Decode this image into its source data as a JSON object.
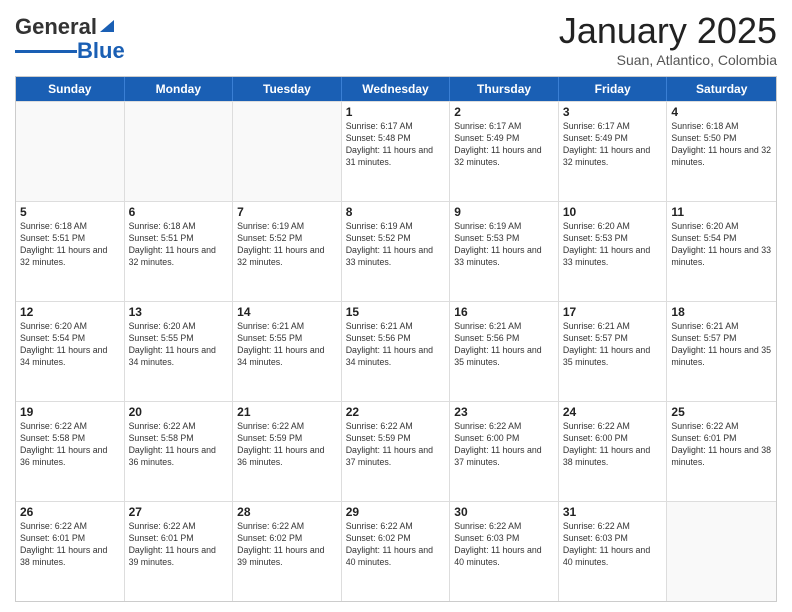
{
  "header": {
    "logo_general": "General",
    "logo_blue": "Blue",
    "month_title": "January 2025",
    "subtitle": "Suan, Atlantico, Colombia"
  },
  "weekdays": [
    "Sunday",
    "Monday",
    "Tuesday",
    "Wednesday",
    "Thursday",
    "Friday",
    "Saturday"
  ],
  "weeks": [
    [
      {
        "day": "",
        "info": ""
      },
      {
        "day": "",
        "info": ""
      },
      {
        "day": "",
        "info": ""
      },
      {
        "day": "1",
        "info": "Sunrise: 6:17 AM\nSunset: 5:48 PM\nDaylight: 11 hours and 31 minutes."
      },
      {
        "day": "2",
        "info": "Sunrise: 6:17 AM\nSunset: 5:49 PM\nDaylight: 11 hours and 32 minutes."
      },
      {
        "day": "3",
        "info": "Sunrise: 6:17 AM\nSunset: 5:49 PM\nDaylight: 11 hours and 32 minutes."
      },
      {
        "day": "4",
        "info": "Sunrise: 6:18 AM\nSunset: 5:50 PM\nDaylight: 11 hours and 32 minutes."
      }
    ],
    [
      {
        "day": "5",
        "info": "Sunrise: 6:18 AM\nSunset: 5:51 PM\nDaylight: 11 hours and 32 minutes."
      },
      {
        "day": "6",
        "info": "Sunrise: 6:18 AM\nSunset: 5:51 PM\nDaylight: 11 hours and 32 minutes."
      },
      {
        "day": "7",
        "info": "Sunrise: 6:19 AM\nSunset: 5:52 PM\nDaylight: 11 hours and 32 minutes."
      },
      {
        "day": "8",
        "info": "Sunrise: 6:19 AM\nSunset: 5:52 PM\nDaylight: 11 hours and 33 minutes."
      },
      {
        "day": "9",
        "info": "Sunrise: 6:19 AM\nSunset: 5:53 PM\nDaylight: 11 hours and 33 minutes."
      },
      {
        "day": "10",
        "info": "Sunrise: 6:20 AM\nSunset: 5:53 PM\nDaylight: 11 hours and 33 minutes."
      },
      {
        "day": "11",
        "info": "Sunrise: 6:20 AM\nSunset: 5:54 PM\nDaylight: 11 hours and 33 minutes."
      }
    ],
    [
      {
        "day": "12",
        "info": "Sunrise: 6:20 AM\nSunset: 5:54 PM\nDaylight: 11 hours and 34 minutes."
      },
      {
        "day": "13",
        "info": "Sunrise: 6:20 AM\nSunset: 5:55 PM\nDaylight: 11 hours and 34 minutes."
      },
      {
        "day": "14",
        "info": "Sunrise: 6:21 AM\nSunset: 5:55 PM\nDaylight: 11 hours and 34 minutes."
      },
      {
        "day": "15",
        "info": "Sunrise: 6:21 AM\nSunset: 5:56 PM\nDaylight: 11 hours and 34 minutes."
      },
      {
        "day": "16",
        "info": "Sunrise: 6:21 AM\nSunset: 5:56 PM\nDaylight: 11 hours and 35 minutes."
      },
      {
        "day": "17",
        "info": "Sunrise: 6:21 AM\nSunset: 5:57 PM\nDaylight: 11 hours and 35 minutes."
      },
      {
        "day": "18",
        "info": "Sunrise: 6:21 AM\nSunset: 5:57 PM\nDaylight: 11 hours and 35 minutes."
      }
    ],
    [
      {
        "day": "19",
        "info": "Sunrise: 6:22 AM\nSunset: 5:58 PM\nDaylight: 11 hours and 36 minutes."
      },
      {
        "day": "20",
        "info": "Sunrise: 6:22 AM\nSunset: 5:58 PM\nDaylight: 11 hours and 36 minutes."
      },
      {
        "day": "21",
        "info": "Sunrise: 6:22 AM\nSunset: 5:59 PM\nDaylight: 11 hours and 36 minutes."
      },
      {
        "day": "22",
        "info": "Sunrise: 6:22 AM\nSunset: 5:59 PM\nDaylight: 11 hours and 37 minutes."
      },
      {
        "day": "23",
        "info": "Sunrise: 6:22 AM\nSunset: 6:00 PM\nDaylight: 11 hours and 37 minutes."
      },
      {
        "day": "24",
        "info": "Sunrise: 6:22 AM\nSunset: 6:00 PM\nDaylight: 11 hours and 38 minutes."
      },
      {
        "day": "25",
        "info": "Sunrise: 6:22 AM\nSunset: 6:01 PM\nDaylight: 11 hours and 38 minutes."
      }
    ],
    [
      {
        "day": "26",
        "info": "Sunrise: 6:22 AM\nSunset: 6:01 PM\nDaylight: 11 hours and 38 minutes."
      },
      {
        "day": "27",
        "info": "Sunrise: 6:22 AM\nSunset: 6:01 PM\nDaylight: 11 hours and 39 minutes."
      },
      {
        "day": "28",
        "info": "Sunrise: 6:22 AM\nSunset: 6:02 PM\nDaylight: 11 hours and 39 minutes."
      },
      {
        "day": "29",
        "info": "Sunrise: 6:22 AM\nSunset: 6:02 PM\nDaylight: 11 hours and 40 minutes."
      },
      {
        "day": "30",
        "info": "Sunrise: 6:22 AM\nSunset: 6:03 PM\nDaylight: 11 hours and 40 minutes."
      },
      {
        "day": "31",
        "info": "Sunrise: 6:22 AM\nSunset: 6:03 PM\nDaylight: 11 hours and 40 minutes."
      },
      {
        "day": "",
        "info": ""
      }
    ]
  ]
}
